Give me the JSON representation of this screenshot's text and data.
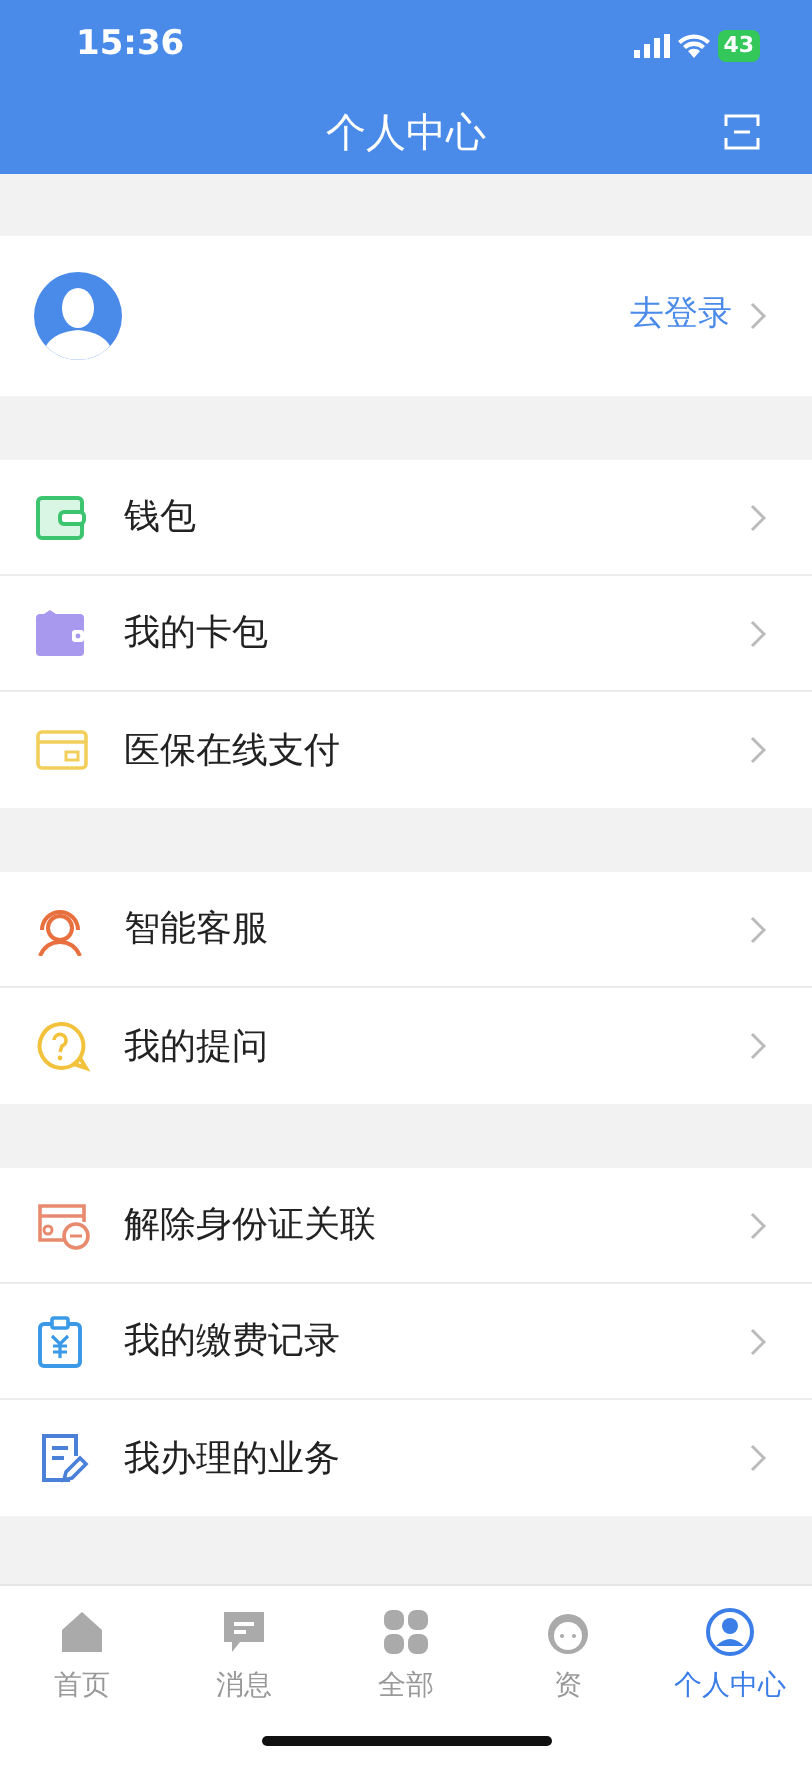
{
  "status_bar": {
    "time": "15:36",
    "battery": "43"
  },
  "header": {
    "title": "个人中心"
  },
  "profile": {
    "action": "去登录"
  },
  "groups": [
    {
      "items": [
        {
          "label": "钱包"
        },
        {
          "label": "我的卡包"
        },
        {
          "label": "医保在线支付"
        }
      ]
    },
    {
      "items": [
        {
          "label": "智能客服"
        },
        {
          "label": "我的提问"
        }
      ]
    },
    {
      "items": [
        {
          "label": "解除身份证关联"
        },
        {
          "label": "我的缴费记录"
        },
        {
          "label": "我办理的业务"
        }
      ]
    }
  ],
  "tabs": [
    {
      "label": "首页",
      "selected": false
    },
    {
      "label": "消息",
      "selected": false
    },
    {
      "label": "全部",
      "selected": false
    },
    {
      "label": "资",
      "selected": false
    },
    {
      "label": "个人中心",
      "selected": true
    }
  ]
}
